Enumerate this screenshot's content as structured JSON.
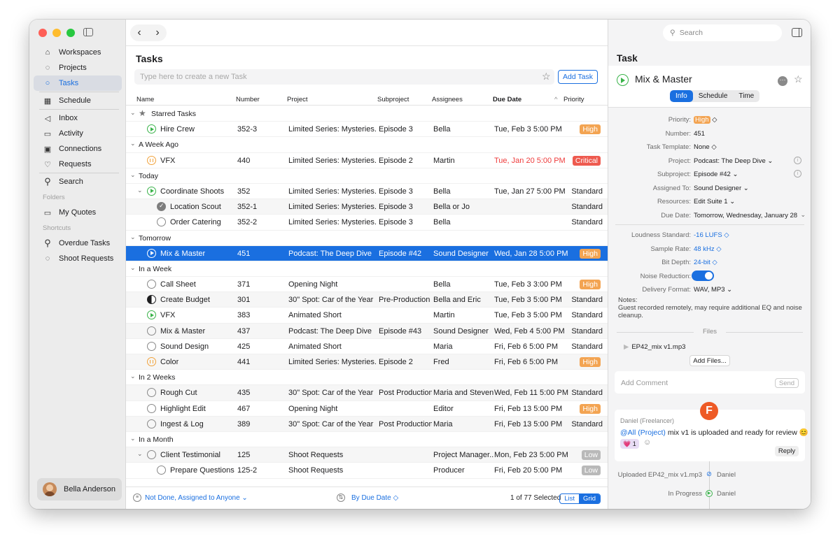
{
  "colors": {
    "accent": "#1a6fe0",
    "high": "#f3a452",
    "critical": "#ee5a4f",
    "low": "#b9b9b9",
    "play": "#3ab34a",
    "pause": "#f1a23a"
  },
  "sidebar": {
    "items": [
      {
        "label": "Workspaces",
        "icon": "building-icon"
      },
      {
        "label": "Projects",
        "icon": "dashed-circle-icon"
      },
      {
        "label": "Tasks",
        "icon": "circle-icon"
      },
      {
        "label": "Schedule",
        "icon": "calendar-icon"
      },
      {
        "label": "Inbox",
        "icon": "megaphone-icon"
      },
      {
        "label": "Activity",
        "icon": "activity-icon"
      },
      {
        "label": "Connections",
        "icon": "contact-card-icon"
      },
      {
        "label": "Requests",
        "icon": "requests-icon"
      },
      {
        "label": "Search",
        "icon": "search-icon"
      }
    ],
    "folders_label": "Folders",
    "folder": "My Quotes",
    "shortcuts_label": "Shortcuts",
    "shortcuts": [
      "Overdue Tasks",
      "Shoot Requests"
    ],
    "user": "Bella Anderson"
  },
  "main": {
    "title": "Tasks",
    "new_task_placeholder": "Type here to create a new Task",
    "add_task": "Add Task",
    "columns": {
      "name": "Name",
      "number": "Number",
      "project": "Project",
      "subproject": "Subproject",
      "assignees": "Assignees",
      "due": "Due Date",
      "sort": "^",
      "priority": "Priority"
    },
    "rows": [
      {
        "type": "group",
        "label": "Starred Tasks",
        "star": true
      },
      {
        "type": "task",
        "status": "play",
        "name": "Hire Crew",
        "number": "352-3",
        "project": "Limited Series: Mysteries...",
        "sub": "Episode 3",
        "assignee": "Bella",
        "due": "Tue, Feb 3 5:00 PM",
        "priority": "High",
        "pclass": "high"
      },
      {
        "type": "group",
        "label": "A Week Ago"
      },
      {
        "type": "task",
        "status": "pause",
        "name": "VFX",
        "number": "440",
        "project": "Limited Series: Mysteries...",
        "sub": "Episode 2",
        "assignee": "Martin",
        "due": "Tue, Jan 20 5:00 PM",
        "dueRed": true,
        "priority": "Critical",
        "pclass": "crit"
      },
      {
        "type": "group",
        "label": "Today"
      },
      {
        "type": "task",
        "status": "play",
        "expand": true,
        "name": "Coordinate Shoots",
        "number": "352",
        "project": "Limited Series: Mysteries...",
        "sub": "Episode 3",
        "assignee": "Bella",
        "due": "Tue, Jan 27 5:00 PM",
        "priority": "Standard",
        "pclass": "std"
      },
      {
        "type": "task",
        "status": "done",
        "indent": true,
        "name": "Location Scout",
        "number": "352-1",
        "project": "Limited Series: Mysteries...",
        "sub": "Episode 3",
        "assignee": "Bella or Jo",
        "due": "",
        "priority": "Standard",
        "pclass": "std"
      },
      {
        "type": "task",
        "status": "open",
        "indent": true,
        "name": "Order Catering",
        "number": "352-2",
        "project": "Limited Series: Mysteries...",
        "sub": "Episode 3",
        "assignee": "Bella",
        "due": "",
        "priority": "Standard",
        "pclass": "std"
      },
      {
        "type": "group",
        "label": "Tomorrow"
      },
      {
        "type": "task",
        "status": "play",
        "selected": true,
        "name": "Mix & Master",
        "number": "451",
        "project": "Podcast: The Deep Dive",
        "sub": "Episode #42",
        "assignee": "Sound Designer",
        "due": "Wed, Jan 28 5:00 PM",
        "priority": "High",
        "pclass": "high"
      },
      {
        "type": "group",
        "label": "In a Week"
      },
      {
        "type": "task",
        "status": "open",
        "name": "Call Sheet",
        "number": "371",
        "project": "Opening Night",
        "sub": "",
        "assignee": "Bella",
        "due": "Tue, Feb 3 3:00 PM",
        "priority": "High",
        "pclass": "high"
      },
      {
        "type": "task",
        "status": "half",
        "name": "Create Budget",
        "number": "301",
        "project": "30\" Spot: Car of the Year",
        "sub": "Pre-Production",
        "assignee": "Bella and Eric",
        "due": "Tue, Feb 3 5:00 PM",
        "priority": "Standard",
        "pclass": "std"
      },
      {
        "type": "task",
        "status": "play",
        "name": "VFX",
        "number": "383",
        "project": "Animated Short",
        "sub": "",
        "assignee": "Martin",
        "due": "Tue, Feb 3 5:00 PM",
        "priority": "Standard",
        "pclass": "std"
      },
      {
        "type": "task",
        "status": "open",
        "name": "Mix & Master",
        "number": "437",
        "project": "Podcast: The Deep Dive",
        "sub": "Episode #43",
        "assignee": "Sound Designer",
        "due": "Wed, Feb 4 5:00 PM",
        "priority": "Standard",
        "pclass": "std"
      },
      {
        "type": "task",
        "status": "open",
        "name": "Sound Design",
        "number": "425",
        "project": "Animated Short",
        "sub": "",
        "assignee": "Maria",
        "due": "Fri, Feb 6 5:00 PM",
        "priority": "Standard",
        "pclass": "std"
      },
      {
        "type": "task",
        "status": "pause",
        "name": "Color",
        "number": "441",
        "project": "Limited Series: Mysteries...",
        "sub": "Episode 2",
        "assignee": "Fred",
        "due": "Fri, Feb 6 5:00 PM",
        "priority": "High",
        "pclass": "high"
      },
      {
        "type": "group",
        "label": "In 2 Weeks"
      },
      {
        "type": "task",
        "status": "open",
        "name": "Rough Cut",
        "number": "435",
        "project": "30\" Spot: Car of the Year",
        "sub": "Post Production",
        "assignee": "Maria and Steven",
        "due": "Wed, Feb 11 5:00 PM",
        "priority": "Standard",
        "pclass": "std"
      },
      {
        "type": "task",
        "status": "open",
        "name": "Highlight Edit",
        "number": "467",
        "project": "Opening Night",
        "sub": "",
        "assignee": "Editor",
        "due": "Fri, Feb 13 5:00 PM",
        "priority": "High",
        "pclass": "high"
      },
      {
        "type": "task",
        "status": "open",
        "name": "Ingest & Log",
        "number": "389",
        "project": "30\" Spot: Car of the Year",
        "sub": "Post Production",
        "assignee": "Maria",
        "due": "Fri, Feb 13 5:00 PM",
        "priority": "Standard",
        "pclass": "std"
      },
      {
        "type": "group",
        "label": "In a Month"
      },
      {
        "type": "task",
        "status": "open",
        "expand": true,
        "name": "Client Testimonial",
        "number": "125",
        "project": "Shoot Requests",
        "sub": "",
        "assignee": "Project Manager...",
        "due": "Mon, Feb 23 5:00 PM",
        "priority": "Low",
        "pclass": "low"
      },
      {
        "type": "task",
        "status": "open",
        "indent": true,
        "name": "Prepare Questions",
        "number": "125-2",
        "project": "Shoot Requests",
        "sub": "",
        "assignee": "Producer",
        "due": "Fri, Feb 20 5:00 PM",
        "priority": "Low",
        "pclass": "low"
      }
    ],
    "filter": "Not Done, Assigned to Anyone",
    "sort_by": "By Due Date",
    "selected_count": "1 of 77 Selected",
    "view_list": "List",
    "view_grid": "Grid"
  },
  "detail": {
    "search_placeholder": "Search",
    "panel_title": "Task",
    "task_name": "Mix & Master",
    "tabs": [
      "Info",
      "Schedule",
      "Time"
    ],
    "props": [
      {
        "k": "Priority:",
        "v": "High",
        "kind": "pill"
      },
      {
        "k": "Number:",
        "v": "451"
      },
      {
        "k": "Task Template:",
        "v": "None ◇"
      },
      {
        "k": "Project:",
        "v": "Podcast: The Deep Dive ⌄",
        "info": true
      },
      {
        "k": "Subproject:",
        "v": "Episode #42 ⌄",
        "info": true
      },
      {
        "k": "Assigned To:",
        "v": "Sound Designer ⌄"
      },
      {
        "k": "Resources:",
        "v": "Edit Suite 1 ⌄"
      },
      {
        "k": "Due Date:",
        "v": "Tomorrow, Wednesday, January 28"
      },
      {
        "kind": "line"
      },
      {
        "k": "Loudness Standard:",
        "v": "-16 LUFS ◇",
        "blue": true
      },
      {
        "k": "Sample Rate:",
        "v": "48 kHz ◇",
        "blue": true
      },
      {
        "k": "Bit Depth:",
        "v": "24-bit ◇",
        "blue": true
      },
      {
        "k": "Noise Reduction:",
        "v": "",
        "kind": "toggle"
      },
      {
        "k": "Delivery Format:",
        "v": "WAV, MP3 ⌄"
      }
    ],
    "notes_label": "Notes:",
    "notes": "Guest recorded remotely, may require additional EQ and noise cleanup.",
    "files_label": "Files",
    "file": "EP42_mix v1.mp3",
    "add_files": "Add Files...",
    "comment_placeholder": "Add Comment",
    "send": "Send",
    "msg_author": "Daniel (Freelancer)",
    "msg_mention": "@All (Project)",
    "msg_text": " mix v1 is uploaded and ready for review 😊",
    "reaction": "💗 1",
    "reply": "Reply",
    "avatar_letter": "F",
    "log": [
      {
        "text": "Uploaded EP42_mix v1.mp3",
        "icon": "paperclip-icon",
        "who": "Daniel"
      },
      {
        "text": "In Progress",
        "icon": "play-icon",
        "who": "Daniel"
      }
    ]
  }
}
